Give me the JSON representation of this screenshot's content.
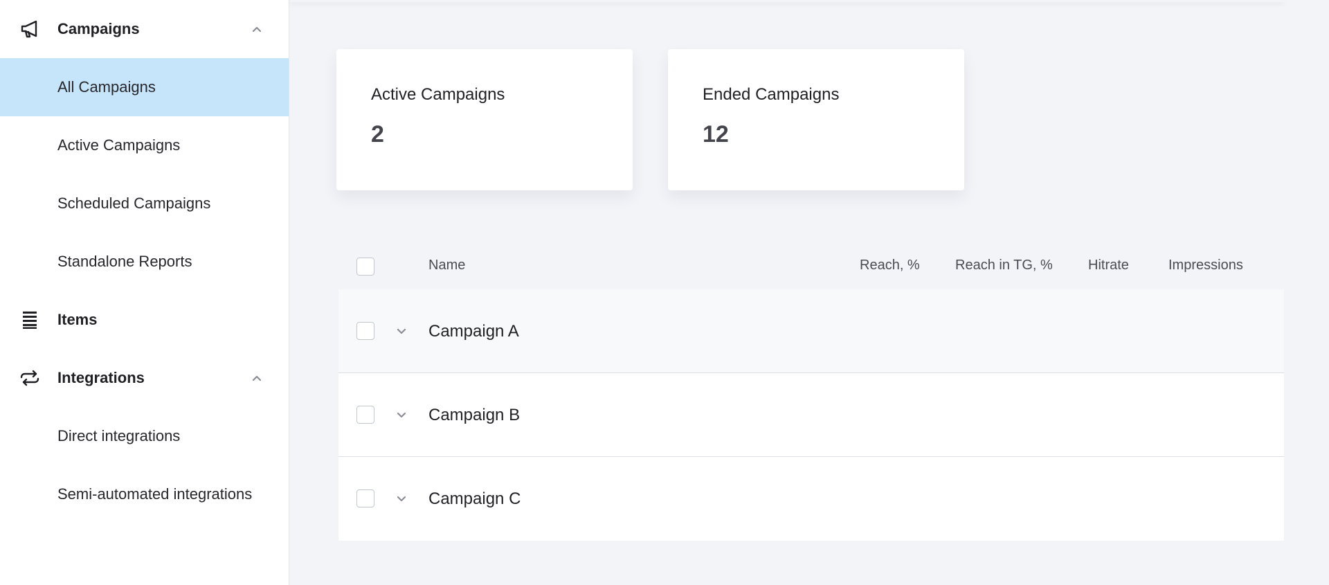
{
  "sidebar": {
    "campaigns": {
      "icon": "megaphone-icon",
      "label": "Campaigns",
      "items": [
        {
          "label": "All Campaigns",
          "selected": true
        },
        {
          "label": "Active Campaigns",
          "selected": false
        },
        {
          "label": "Scheduled Campaigns",
          "selected": false
        },
        {
          "label": "Standalone Reports",
          "selected": false
        }
      ]
    },
    "items_section": {
      "icon": "list-icon",
      "label": "Items"
    },
    "integrations": {
      "icon": "repeat-arrows-icon",
      "label": "Integrations",
      "items": [
        {
          "label": "Direct integrations"
        },
        {
          "label": "Semi-automated integrations"
        }
      ]
    }
  },
  "stats": {
    "active": {
      "label": "Active Campaigns",
      "value": "2"
    },
    "ended": {
      "label": "Ended Campaigns",
      "value": "12"
    }
  },
  "table": {
    "columns": {
      "name": "Name",
      "reach": "Reach, %",
      "reach_tg": "Reach in TG, %",
      "hitrate": "Hitrate",
      "impressions": "Impressions"
    },
    "rows": [
      {
        "name": "Campaign A"
      },
      {
        "name": "Campaign B"
      },
      {
        "name": "Campaign C"
      }
    ]
  },
  "colors": {
    "selected_bg": "#c6e5fa",
    "page_bg": "#f3f4f8",
    "card_bg": "#ffffff"
  }
}
